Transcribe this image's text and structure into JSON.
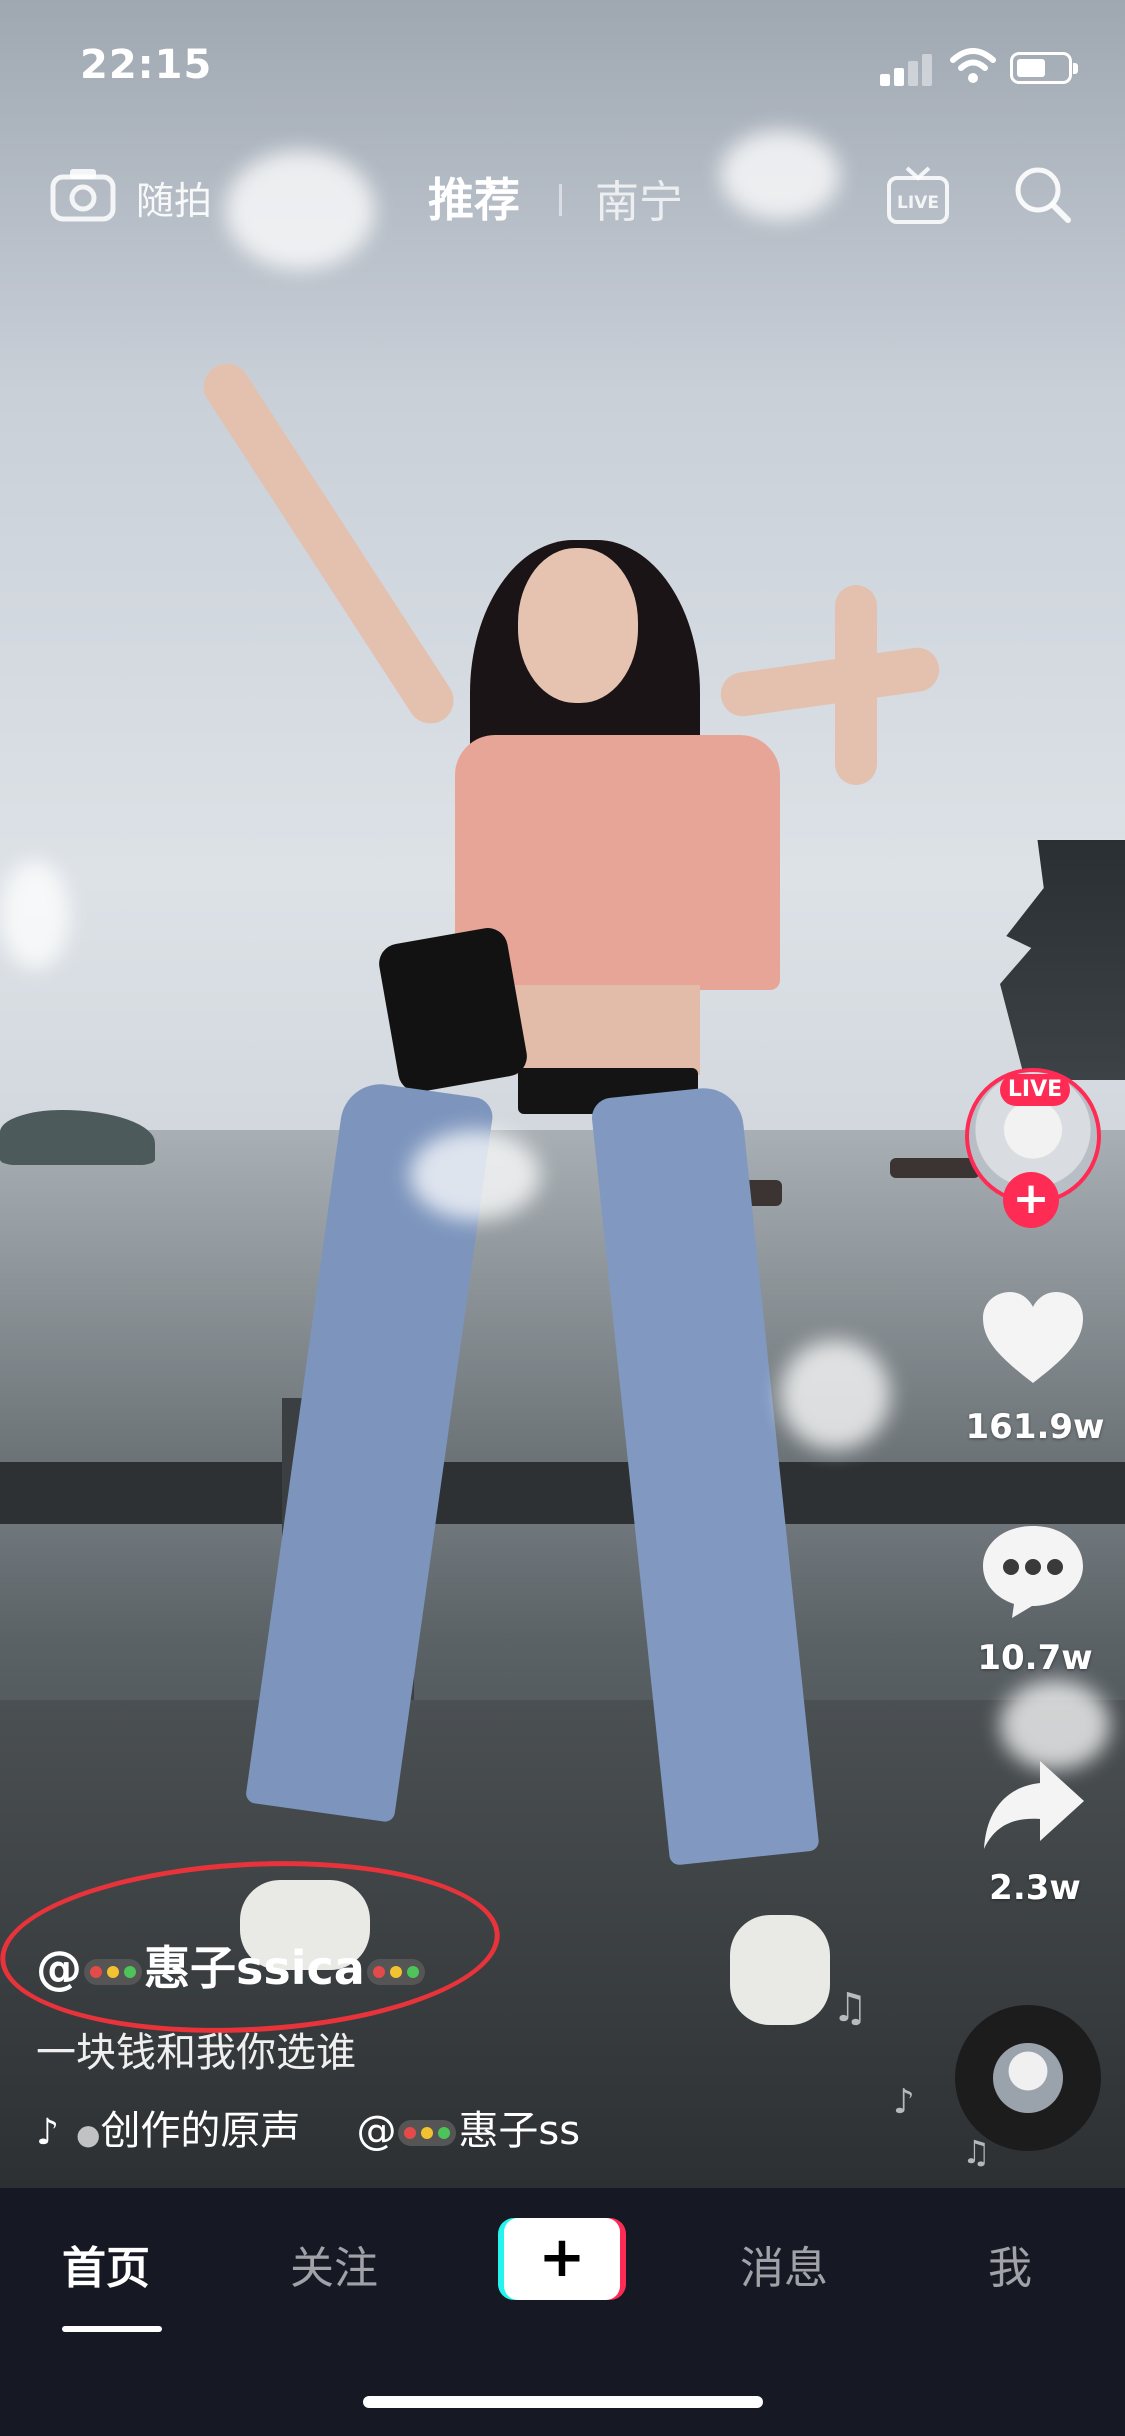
{
  "status_bar": {
    "time": "22:15"
  },
  "top_nav": {
    "snap_label": "随拍",
    "tab_recommend": "推荐",
    "tab_city": "南宁",
    "live_icon_text": "LIVE"
  },
  "right_rail": {
    "live_badge": "LIVE",
    "likes": "161.9w",
    "comments": "10.7w",
    "shares": "2.3w"
  },
  "caption": {
    "author_prefix": "@",
    "author_name_a": "惠子ssica",
    "description": "一块钱和我你选谁",
    "music_source": "创作的原声",
    "music_author": "@",
    "music_author_name": "惠子ss"
  },
  "tab_bar": {
    "home": "首页",
    "follow": "关注",
    "create": "+",
    "messages": "消息",
    "me": "我"
  },
  "colors": {
    "accent": "#fe2c55",
    "accent2": "#25f4ee",
    "tabbar_bg": "#161823",
    "annotation_red": "#e9333a"
  }
}
